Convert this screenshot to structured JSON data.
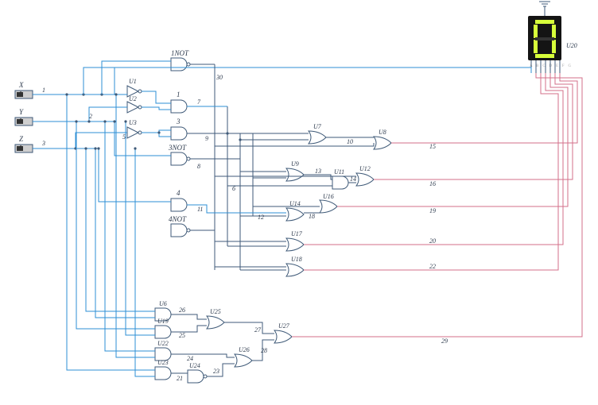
{
  "inputs": {
    "X": {
      "label": "X",
      "value": "1"
    },
    "Y": {
      "label": "Y",
      "value": "1"
    },
    "Z": {
      "label": "Z",
      "value": "1"
    }
  },
  "gates": {
    "not_top": "1NOT",
    "u1": "U1",
    "u2": "U2",
    "u3": "U3",
    "and1": "1",
    "and3": "3",
    "and3not": "3NOT",
    "and4": "4",
    "and4not": "4NOT",
    "u6": "U6",
    "u19": "U19",
    "u22": "U22",
    "u23": "U23",
    "u24": "U24",
    "u25": "U25",
    "u26": "U26",
    "u27": "U27",
    "u7": "U7",
    "u8": "U8",
    "u9": "U9",
    "u11": "U11",
    "u12": "U12",
    "u14": "U14",
    "u16": "U16",
    "u17": "U17",
    "u18": "U18"
  },
  "wires": {
    "w1": "1",
    "w2": "2",
    "w3": "3",
    "w5": "5",
    "w6": "6",
    "w7": "7",
    "w8": "8",
    "w9": "9",
    "w10": "10",
    "w11": "11",
    "w12": "12",
    "w13": "13",
    "w14": "14",
    "w15": "15",
    "w16": "16",
    "w18": "18",
    "w19": "19",
    "w20": "20",
    "w21": "21",
    "w22": "22",
    "w23": "23",
    "w24": "24",
    "w25": "25",
    "w26": "26",
    "w27": "27",
    "w28": "28",
    "w29": "29",
    "w30": "30"
  },
  "display": {
    "ref": "U20",
    "pins": "A B C D E F G"
  }
}
